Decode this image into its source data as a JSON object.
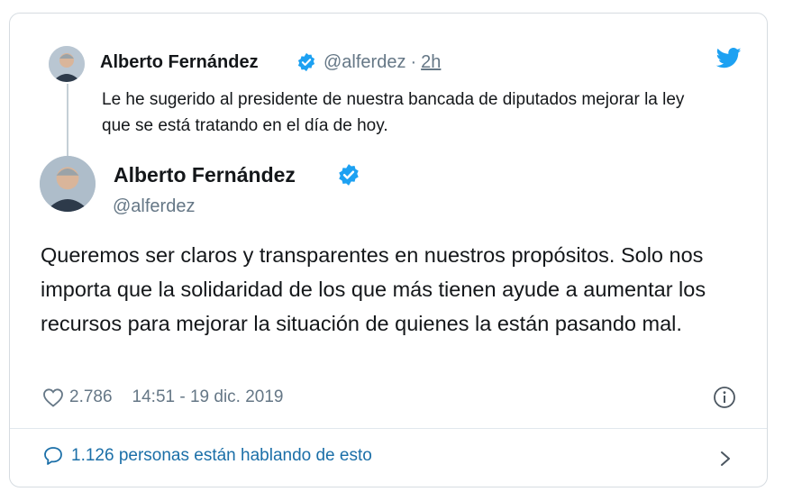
{
  "quoted_tweet": {
    "author_name": "Alberto Fernández",
    "handle": "@alferdez",
    "separator": "·",
    "time_ago": "2h",
    "text": "Le he sugerido al presidente de nuestra bancada de diputados mejorar la ley que se está tratando en el día de hoy."
  },
  "main_tweet": {
    "author_name": "Alberto Fernández",
    "handle": "@alferdez",
    "text": "Queremos ser claros y transparentes en nuestros propósitos. Solo nos importa que la solidaridad de los que más tienen ayude a aumentar los recursos para mejorar la situación de quienes la están pasando mal.",
    "like_count": "2.786",
    "timestamp": "14:51 - 19 dic. 2019"
  },
  "conversation": {
    "label": "1.126 personas están hablando de esto"
  },
  "icons": {
    "brand": "twitter-bird-icon",
    "verified": "verified-badge-icon",
    "like": "heart-icon",
    "info": "info-icon",
    "reply": "comment-icon",
    "chevron": "chevron-right-icon"
  },
  "colors": {
    "brand_blue": "#1da1f2",
    "secondary_text": "#657786",
    "link_text": "#1b6fa8",
    "border": "#d6dce1"
  }
}
